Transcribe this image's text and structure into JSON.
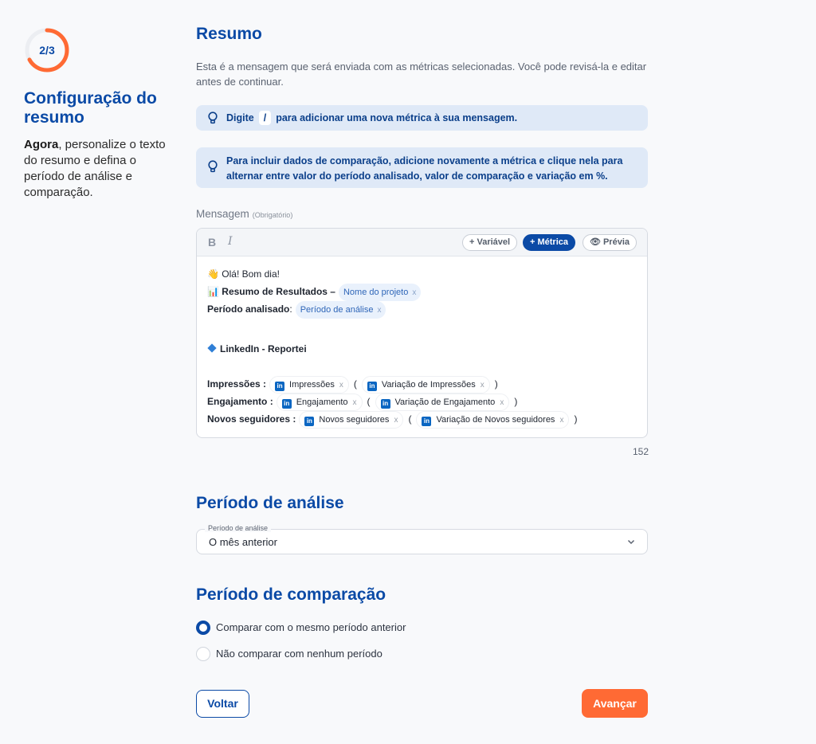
{
  "sidebar": {
    "step": "2/3",
    "progress_fraction": 0.67,
    "title": "Configuração do resumo",
    "desc_bold": "Agora",
    "desc_rest": ", personalize o texto do resumo e defina o período de análise e comparação."
  },
  "summary": {
    "heading": "Resumo",
    "intro": "Esta é a mensagem que será enviada com as métricas selecionadas. Você pode revisá-la e editar antes de continuar.",
    "tip1_before": "Digite",
    "tip1_key": "/",
    "tip1_after": "para adicionar uma nova métrica à sua mensagem.",
    "tip2": "Para incluir dados de comparação, adicione novamente a métrica e clique nela para alternar entre valor do período analisado, valor de comparação e variação em %."
  },
  "editor": {
    "label": "Mensagem",
    "required": "(Obrigatório)",
    "toolbar": {
      "bold": "B",
      "italic": "I",
      "variable": "+ Variável",
      "metric": "+ Métrica",
      "preview": "Prévia"
    },
    "greeting": "👋 Olá! Bom dia!",
    "results_label": "📊 Resumo de Resultados –",
    "project_chip": "Nome do projeto",
    "period_label": "Período analisado",
    "period_chip": "Período de análise",
    "section_title": "LinkedIn - Reportei",
    "rows": [
      {
        "label": "Impressões",
        "metric": "Impressões",
        "variation": "Variação de Impressões"
      },
      {
        "label": "Engajamento",
        "metric": "Engajamento",
        "variation": "Variação de Engajamento"
      },
      {
        "label": "Novos seguidores",
        "metric": "Novos seguidores",
        "variation": "Variação de Novos seguidores"
      }
    ],
    "char_count": "152"
  },
  "analysis": {
    "heading": "Período de análise",
    "field_label": "Período de análise",
    "value": "O mês anterior"
  },
  "comparison": {
    "heading": "Período de comparação",
    "options": [
      "Comparar com o mesmo período anterior",
      "Não comparar com nenhum período"
    ],
    "selected": 0
  },
  "actions": {
    "back": "Voltar",
    "next": "Avançar"
  },
  "colors": {
    "primary": "#0b4aa6",
    "accent": "#ff6a34",
    "info_bg": "#dfe9f7"
  },
  "icons": {
    "tip": "lightbulb-icon",
    "select": "chevron-down-icon",
    "preview": "eye-icon",
    "metric_source": "linkedin-icon"
  }
}
